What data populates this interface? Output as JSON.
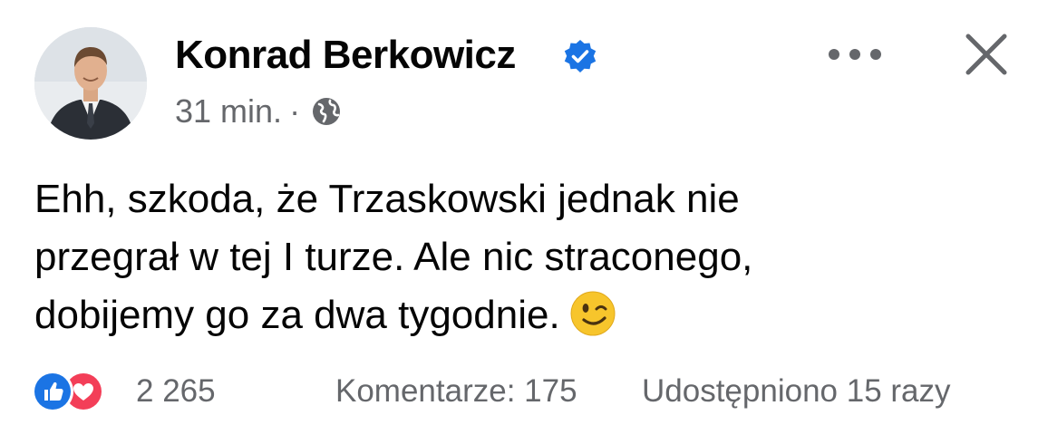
{
  "post": {
    "author": {
      "name": "Konrad Berkowicz",
      "verified": true,
      "avatar": "profile-photo"
    },
    "timestamp": "31 min.",
    "separator": "·",
    "privacy_icon": "globe-icon",
    "actions": {
      "more_icon": "more-options-icon",
      "close_icon": "close-icon"
    },
    "text_lines": [
      "Ehh, szkoda, że Trzaskowski jednak nie",
      "przegrał w tej I turze. Ale nic straconego,",
      "dobijemy go za dwa tygodnie."
    ],
    "emoji": "winking-face",
    "footer": {
      "reaction_icons": [
        "like-icon",
        "love-icon"
      ],
      "reaction_count": "2 265",
      "comments": "Komentarze: 175",
      "shares": "Udostępniono 15 razy"
    }
  },
  "colors": {
    "text": "#050505",
    "secondary_text": "#65676b",
    "verified_blue": "#1b74e4",
    "like_blue": "#1b74e4",
    "love_red": "#f33e58",
    "emoji_yellow": "#f7c52c"
  }
}
